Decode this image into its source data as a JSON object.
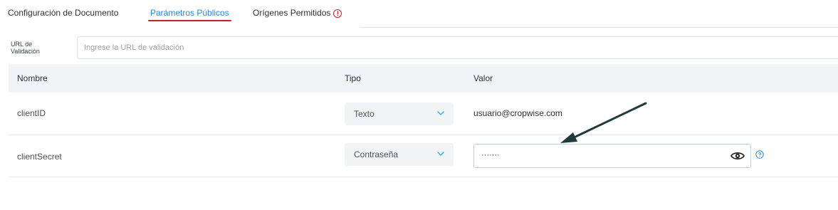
{
  "tabs": [
    {
      "label": "Configuración de Documento",
      "active": false
    },
    {
      "label": "Parámetros Públicos",
      "active": true
    },
    {
      "label": "Orígenes Permitidos",
      "active": false,
      "warning": true
    }
  ],
  "url_field": {
    "label": "URL de Validación",
    "label_line1": "URL de",
    "label_line2": "Validación",
    "placeholder": "Ingrese la URL de validación",
    "value": ""
  },
  "table": {
    "headers": {
      "name": "Nombre",
      "type": "Tipo",
      "value": "Valor"
    },
    "rows": [
      {
        "name": "clientID",
        "type": "Texto",
        "value": "usuario@cropwise.com"
      },
      {
        "name": "clientSecret",
        "type": "Contraseña",
        "value": "·······"
      }
    ]
  },
  "icons": {
    "warning": "alert-circle-icon",
    "chevron": "chevron-down-icon",
    "show_password": "eye-icon",
    "help": "question-circle-icon"
  },
  "colors": {
    "accent_blue": "#1f88e5",
    "active_underline": "#e0171e",
    "warning": "#e0171e",
    "chevron": "#1fb5e8",
    "header_bg": "#f3f4f6",
    "annotation_arrow": "#1f3a3d"
  }
}
